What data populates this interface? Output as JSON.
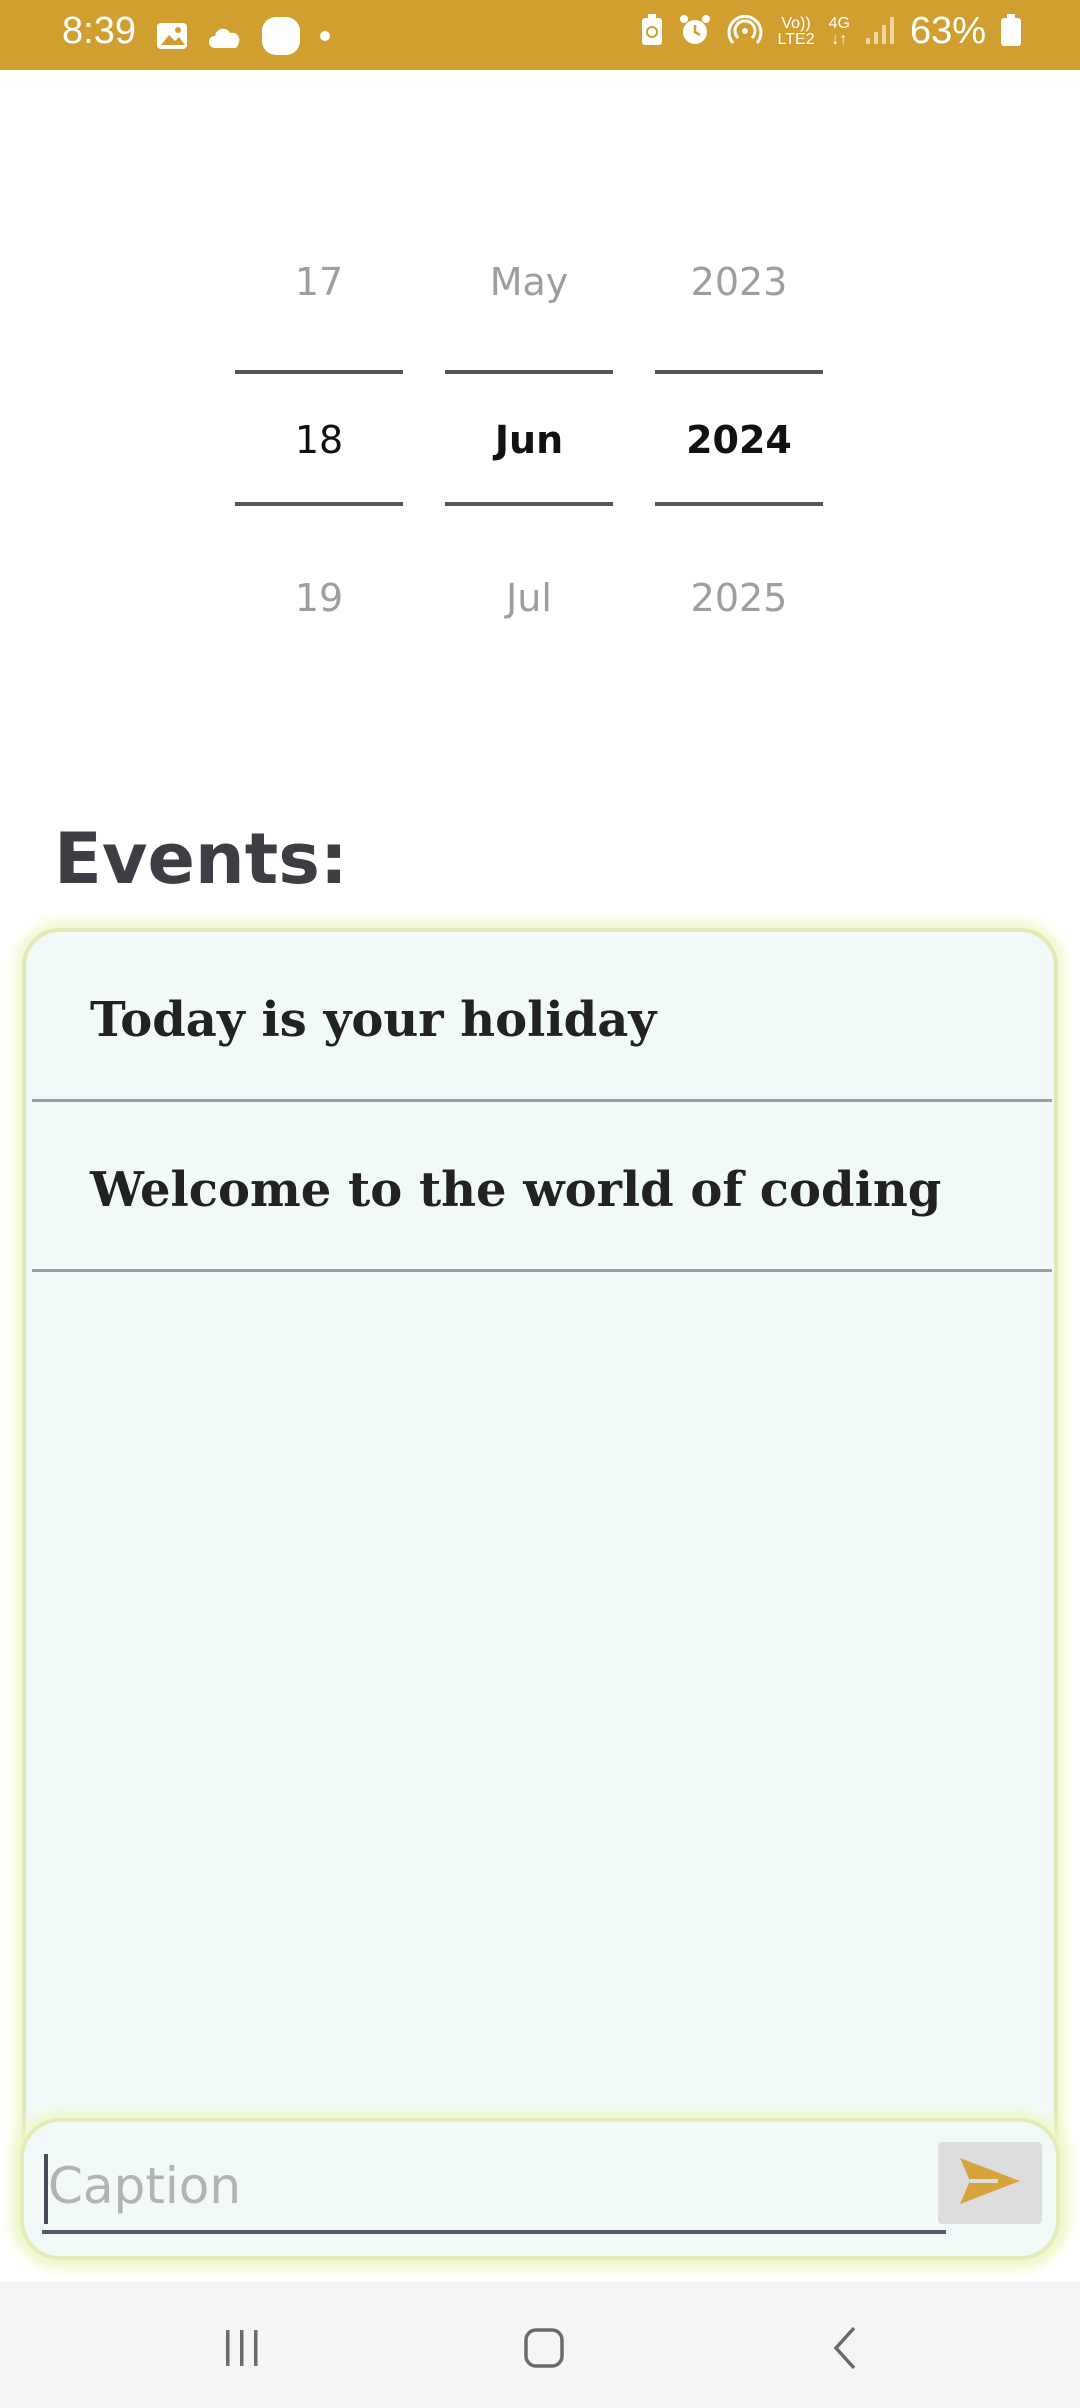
{
  "status_bar": {
    "time": "8:39",
    "battery": "63%",
    "network_label_top": "Vo))",
    "network_label_bottom": "LTE2",
    "network_type": "4G",
    "icons": [
      "image-icon",
      "cloud-icon",
      "app-icon",
      "dot-icon",
      "battery-saver-icon",
      "alarm-icon",
      "hotspot-icon",
      "signal-icon",
      "battery-icon"
    ]
  },
  "date_picker": {
    "day": {
      "prev": "17",
      "selected": "18",
      "next": "19"
    },
    "month": {
      "prev": "May",
      "selected": "Jun",
      "next": "Jul"
    },
    "year": {
      "prev": "2023",
      "selected": "2024",
      "next": "2025"
    }
  },
  "events": {
    "title": "Events:",
    "items": [
      {
        "text": "Today is your holiday"
      },
      {
        "text": "Welcome to the world of coding"
      }
    ]
  },
  "caption": {
    "placeholder": "Caption",
    "value": ""
  },
  "colors": {
    "status_bar": "#d19f30",
    "send_icon": "#d6a33c",
    "card_bg": "#f2faf9",
    "card_glow": "#eef8c7"
  },
  "nav": {
    "icons": [
      "recent-apps-icon",
      "home-icon",
      "back-icon"
    ]
  }
}
